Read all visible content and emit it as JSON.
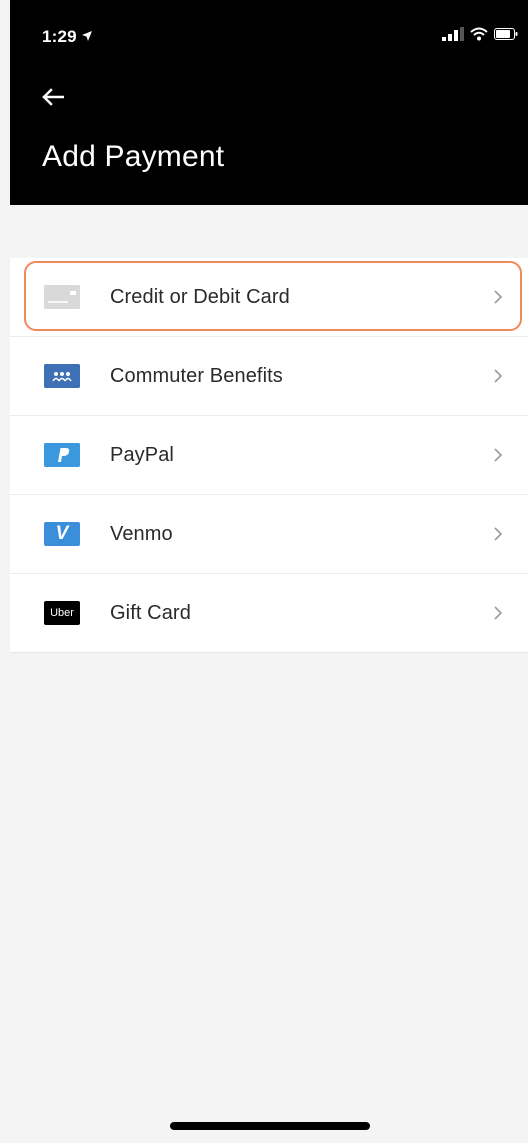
{
  "status_bar": {
    "time": "1:29",
    "icons": [
      "location-arrow-icon",
      "signal-icon",
      "wifi-icon",
      "battery-icon"
    ]
  },
  "header": {
    "back_icon": "back-arrow-icon",
    "title": "Add Payment"
  },
  "payment_methods": [
    {
      "label": "Credit or Debit Card",
      "icon": "credit-card-icon",
      "highlighted": true
    },
    {
      "label": "Commuter Benefits",
      "icon": "commuter-benefits-icon",
      "highlighted": false
    },
    {
      "label": "PayPal",
      "icon": "paypal-icon",
      "highlighted": false
    },
    {
      "label": "Venmo",
      "icon": "venmo-icon",
      "icon_letter": "V",
      "highlighted": false
    },
    {
      "label": "Gift Card",
      "icon": "uber-gift-card-icon",
      "icon_text": "Uber",
      "highlighted": false
    }
  ],
  "colors": {
    "header_background": "#000000",
    "page_background": "#f4f4f4",
    "highlight_outline": "#ef8a5a",
    "commuter_icon": "#3f6fb5",
    "paypal_icon": "#3b97de",
    "venmo_icon": "#3b8ed9",
    "uber_icon": "#000000"
  }
}
